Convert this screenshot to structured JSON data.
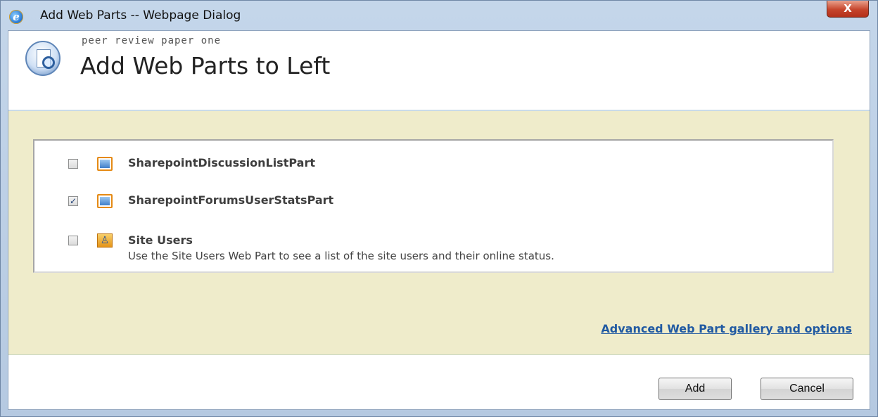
{
  "window": {
    "title": "Add Web Parts -- Webpage Dialog",
    "close_glyph": "X"
  },
  "header": {
    "subtitle": "peer review paper one",
    "title": "Add Web Parts to Left",
    "icon": "page-magnifier-icon"
  },
  "list": {
    "items": [
      {
        "label": "SharepointDiscussionListPart",
        "checked": false,
        "icon": "webpart-icon",
        "description": ""
      },
      {
        "label": "SharepointForumsUserStatsPart",
        "checked": true,
        "icon": "webpart-icon",
        "description": ""
      },
      {
        "label": "Site Users",
        "checked": false,
        "icon": "site-users-icon",
        "description": "Use the Site Users Web Part to see a list of the site users and their online status."
      }
    ]
  },
  "gallery_link": "Advanced Web Part gallery and options",
  "footer": {
    "add_label": "Add",
    "cancel_label": "Cancel"
  },
  "colors": {
    "body_background": "#efeccb",
    "link": "#215aa2"
  }
}
